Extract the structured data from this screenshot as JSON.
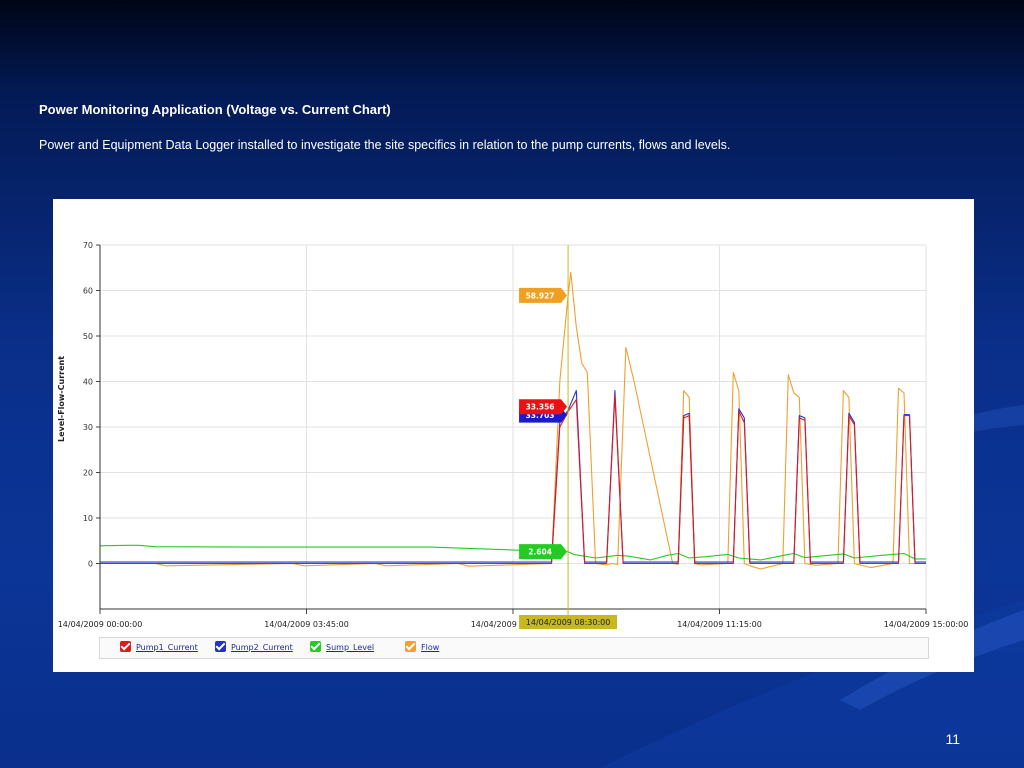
{
  "slide": {
    "title": "Power Monitoring Application (Voltage vs. Current Chart)",
    "subtitle": "Power and Equipment Data Logger installed to investigate the site specifics in relation to the pump currents, flows and levels.",
    "page_number": "11"
  },
  "chart_data": {
    "type": "line",
    "ylabel": "Level-Flow-Current",
    "xlabel": "",
    "ylim": [
      -10,
      70
    ],
    "yticks": [
      0,
      10,
      20,
      30,
      40,
      50,
      60,
      70
    ],
    "xlim_hours": [
      0,
      15
    ],
    "x_ticks": [
      {
        "h": 0,
        "label": "14/04/2009 00:00:00"
      },
      {
        "h": 3.75,
        "label": "14/04/2009 03:45:00"
      },
      {
        "h": 7.5,
        "label": "14/04/2009 07:30:00"
      },
      {
        "h": 11.25,
        "label": "14/04/2009 11:15:00"
      },
      {
        "h": 15,
        "label": "14/04/2009 15:00:00"
      }
    ],
    "cursor": {
      "h": 8.5,
      "label": "14/04/2009 08:30:00"
    },
    "grid": true,
    "legend_position": "bottom",
    "series": [
      {
        "name": "Pump1_Current",
        "color": "#e01a1a",
        "x": [
          0,
          8.2,
          8.35,
          8.5,
          8.65,
          8.8,
          9.0,
          9.2,
          9.35,
          9.5,
          10.5,
          10.6,
          10.7,
          10.8,
          11.5,
          11.6,
          11.7,
          11.8,
          12.6,
          12.7,
          12.8,
          12.9,
          13.5,
          13.6,
          13.7,
          13.8,
          14.5,
          14.6,
          14.7,
          14.8,
          15
        ],
        "y": [
          0,
          0,
          30,
          33.356,
          36,
          0,
          0,
          0,
          37,
          0,
          0,
          32,
          32.5,
          0,
          0,
          33.5,
          31,
          0,
          0,
          32,
          31.5,
          0,
          0,
          32.5,
          30.5,
          0,
          0,
          32.5,
          32.5,
          0,
          0
        ]
      },
      {
        "name": "Pump2_Current",
        "color": "#2233cc",
        "x": [
          0,
          8.2,
          8.35,
          8.5,
          8.65,
          8.8,
          9.0,
          9.2,
          9.35,
          9.5,
          10.5,
          10.6,
          10.7,
          10.8,
          11.5,
          11.6,
          11.7,
          11.8,
          12.6,
          12.7,
          12.8,
          12.9,
          13.5,
          13.6,
          13.7,
          13.8,
          14.5,
          14.6,
          14.7,
          14.8,
          15
        ],
        "y": [
          0.3,
          0.3,
          31,
          33.703,
          38,
          0.3,
          0.3,
          0.3,
          38,
          0.3,
          0.3,
          32.5,
          33,
          0.3,
          0.3,
          34,
          32,
          0.3,
          0.3,
          32.5,
          32,
          0.3,
          0.3,
          33,
          31,
          0.3,
          0.3,
          32.7,
          32.7,
          0.3,
          0.3
        ]
      },
      {
        "name": "Sump_Level",
        "color": "#22cc22",
        "x": [
          0,
          0.5,
          0.7,
          1.0,
          3.0,
          6.0,
          8.4,
          8.5,
          8.6,
          9.0,
          9.4,
          9.6,
          10.0,
          10.3,
          10.5,
          10.7,
          11.0,
          11.4,
          11.6,
          12.0,
          12.5,
          12.6,
          12.8,
          13.3,
          13.5,
          13.7,
          14.2,
          14.6,
          14.8,
          15
        ],
        "y": [
          3.9,
          4.0,
          4.0,
          3.7,
          3.6,
          3.6,
          2.6,
          2.604,
          2.0,
          1.2,
          1.8,
          1.6,
          0.8,
          1.8,
          2.2,
          1.2,
          1.5,
          2.0,
          1.2,
          0.8,
          2.0,
          2.2,
          1.3,
          1.9,
          2.1,
          1.2,
          1.8,
          2.2,
          1.0,
          1.0
        ]
      },
      {
        "name": "Flow",
        "color": "#f0a030",
        "x": [
          0,
          1.0,
          1.2,
          3.5,
          3.7,
          5.0,
          5.2,
          6.5,
          6.7,
          8.2,
          8.35,
          8.5,
          8.55,
          8.65,
          8.75,
          8.85,
          9.0,
          9.2,
          9.3,
          9.4,
          9.55,
          9.7,
          10.4,
          10.5,
          10.6,
          10.7,
          10.8,
          10.9,
          11.4,
          11.5,
          11.6,
          11.7,
          11.8,
          12.0,
          12.4,
          12.5,
          12.6,
          12.7,
          12.8,
          13.0,
          13.4,
          13.5,
          13.6,
          13.7,
          13.8,
          14.0,
          14.4,
          14.5,
          14.6,
          14.7,
          14.8,
          15
        ],
        "y": [
          0,
          0,
          -0.5,
          0,
          -0.5,
          0,
          -0.5,
          0,
          -0.6,
          0,
          40,
          58.927,
          64,
          52,
          44,
          42,
          0,
          -0.3,
          0,
          -0.2,
          47.5,
          40,
          0,
          -0.2,
          38,
          36.5,
          0,
          -0.3,
          0,
          42,
          38,
          0,
          -0.5,
          -1.2,
          0,
          41.5,
          37.5,
          36.5,
          0,
          -0.4,
          0,
          38,
          36.5,
          0,
          -0.3,
          -0.9,
          0,
          38.5,
          37.5,
          0,
          0,
          0
        ]
      }
    ],
    "cursor_labels": [
      {
        "series": "Flow",
        "value": "58.927",
        "color": "#f0a020"
      },
      {
        "series": "Pump2_Current",
        "value": "33.703",
        "color": "#1a1acc"
      },
      {
        "series": "Pump1_Current",
        "value": "33.356",
        "color": "#ee1111"
      },
      {
        "series": "Sump_Level",
        "value": "2.604",
        "color": "#22cc22"
      }
    ]
  },
  "legend": [
    {
      "label": "Pump1_Current",
      "color": "#e01a1a"
    },
    {
      "label": "Pump2_Current",
      "color": "#2233cc"
    },
    {
      "label": "Sump_Level",
      "color": "#22cc22"
    },
    {
      "label": "Flow",
      "color": "#f0a030"
    }
  ]
}
